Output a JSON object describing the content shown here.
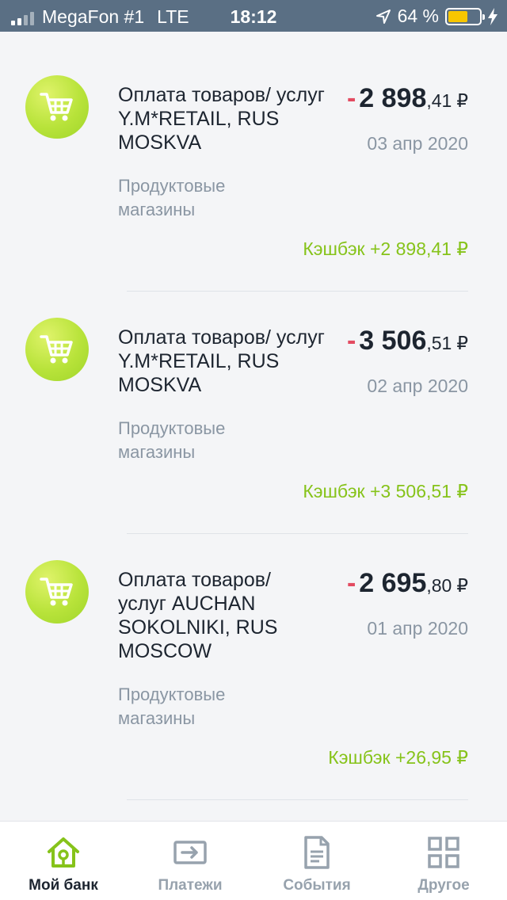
{
  "status": {
    "carrier": "MegaFon #1",
    "network": "LTE",
    "time": "18:12",
    "battery": "64 %"
  },
  "transactions": [
    {
      "icon": "shopping-cart-icon",
      "title": "Оплата товаров/ услуг Y.M*RETAIL, RUS MOSKVA",
      "sign": "-",
      "amount_main": "2 898",
      "amount_cents": ",41",
      "currency": "₽",
      "date": "03 апр 2020",
      "category": "Продуктовые магазины",
      "cashback": "Кэшбэк +2 898,41 ₽"
    },
    {
      "icon": "shopping-cart-icon",
      "title": "Оплата товаров/ услуг Y.M*RETAIL, RUS MOSKVA",
      "sign": "-",
      "amount_main": "3 506",
      "amount_cents": ",51",
      "currency": "₽",
      "date": "02 апр 2020",
      "category": "Продуктовые магазины",
      "cashback": "Кэшбэк +3 506,51 ₽"
    },
    {
      "icon": "shopping-cart-icon",
      "title": "Оплата товаров/ услуг AUCHAN SOKOLNIKI, RUS MOSCOW",
      "sign": "-",
      "amount_main": "2 695",
      "amount_cents": ",80",
      "currency": "₽",
      "date": "01 апр 2020",
      "category": "Продуктовые магазины",
      "cashback": "Кэшбэк +26,95 ₽"
    }
  ],
  "tabbar": [
    {
      "label": "Мой банк",
      "icon": "home-icon",
      "active": true
    },
    {
      "label": "Платежи",
      "icon": "payments-icon",
      "active": false
    },
    {
      "label": "События",
      "icon": "document-icon",
      "active": false
    },
    {
      "label": "Другое",
      "icon": "grid-icon",
      "active": false
    }
  ],
  "colors": {
    "status_bar": "#5a6f84",
    "accent_green": "#86c31a",
    "minus_red": "#e34b61",
    "text_dark": "#1d2530",
    "text_muted": "#8a96a3"
  }
}
